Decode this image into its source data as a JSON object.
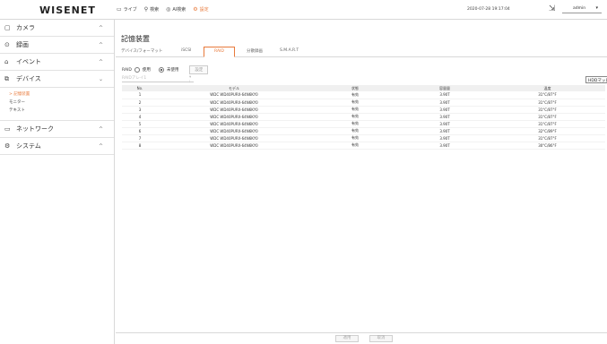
{
  "app": {
    "logo": "WISENET",
    "clock": "2020-07-28 19:17:04",
    "user": "admin",
    "accent": "#e8793a"
  },
  "topnav": [
    {
      "icon": "monitor-icon",
      "label": "ライブ"
    },
    {
      "icon": "search-icon",
      "label": "検索"
    },
    {
      "icon": "ai-search-icon",
      "label": "AI検索"
    },
    {
      "icon": "settings-icon",
      "label": "設定",
      "active": true
    }
  ],
  "sidebar": {
    "items": [
      {
        "icon": "camera-icon",
        "label": "カメラ",
        "chevron": "^"
      },
      {
        "icon": "record-icon",
        "label": "録画",
        "chevron": "^"
      },
      {
        "icon": "event-icon",
        "label": "イベント",
        "chevron": "^"
      },
      {
        "icon": "device-icon",
        "label": "デバイス",
        "chevron": "v"
      },
      {
        "icon": "network-icon",
        "label": "ネットワーク",
        "chevron": "^"
      },
      {
        "icon": "system-icon",
        "label": "システム",
        "chevron": "^"
      }
    ],
    "sub_items": [
      {
        "label": "> 記憶装置",
        "active": true
      },
      {
        "label": "モニター"
      },
      {
        "label": "テキスト"
      }
    ]
  },
  "main": {
    "title": "記憶装置",
    "tabs": [
      "デバイス/フォーマット",
      "iSCSI",
      "RAID",
      "分散録画",
      "S.M.A.R.T"
    ],
    "active_tab": "RAID",
    "raid_label": "RAID",
    "raid_on": "使用",
    "raid_off": "未使用",
    "apply_small": "設定",
    "select_placeholder": "RAIDアレイ1",
    "hdd_button": "HDDマッピング",
    "columns": [
      "No.",
      "モデル",
      "状態",
      "容量量",
      "温度"
    ],
    "rows": [
      {
        "no": "1",
        "model": "WDC WD40PURX-64N6KY0",
        "status": "有効",
        "capacity": "3.90T",
        "temp": "31°C/87°F"
      },
      {
        "no": "2",
        "model": "WDC WD40PURX-64N6KY0",
        "status": "有効",
        "capacity": "3.90T",
        "temp": "31°C/87°F"
      },
      {
        "no": "3",
        "model": "WDC WD40PURX-64N6KY0",
        "status": "有効",
        "capacity": "3.90T",
        "temp": "31°C/87°F"
      },
      {
        "no": "4",
        "model": "WDC WD40PURX-64N6KY0",
        "status": "有効",
        "capacity": "3.90T",
        "temp": "31°C/87°F"
      },
      {
        "no": "5",
        "model": "WDC WD40PURX-64N6KY0",
        "status": "有効",
        "capacity": "3.90T",
        "temp": "31°C/87°F"
      },
      {
        "no": "6",
        "model": "WDC WD40PURX-64N6KY0",
        "status": "有効",
        "capacity": "3.90T",
        "temp": "32°C/89°F"
      },
      {
        "no": "7",
        "model": "WDC WD40PURX-64N6KY0",
        "status": "有効",
        "capacity": "3.90T",
        "temp": "31°C/87°F"
      },
      {
        "no": "8",
        "model": "WDC WD40PURX-64N6KY0",
        "status": "有効",
        "capacity": "3.90T",
        "temp": "30°C/86°F"
      }
    ],
    "apply_label": "適用",
    "cancel_label": "取消"
  }
}
